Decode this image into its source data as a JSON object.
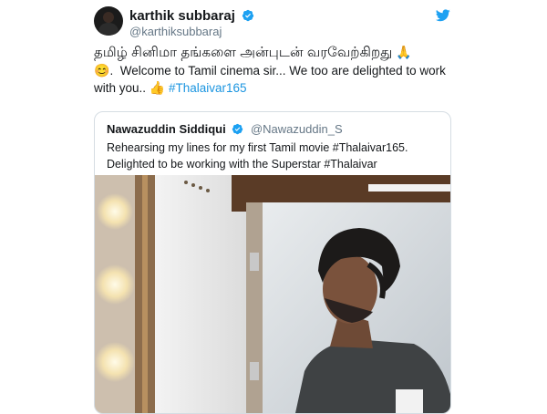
{
  "tweet": {
    "display_name": "karthik subbaraj",
    "handle": "@karthiksubbaraj",
    "text_tamil": "தமிழ் சினிமா தங்களை அன்புடன் வரவேற்கிறது",
    "text_english_line1": "Welcome to Tamil cinema sir... We too are delighted to work",
    "text_english_line2": "with you..",
    "hashtag": "#Thalaivar165",
    "emoji_pray": "🙏",
    "emoji_smile": "😊",
    "emoji_thumbs": "👍"
  },
  "quoted_tweet": {
    "display_name": "Nawazuddin Siddiqui",
    "handle": "@Nawazuddin_S",
    "text_line1": "Rehearsing my lines for my first Tamil movie #Thalaivar165.",
    "text_line2": "Delighted to be working with the Superstar #Thalaivar"
  },
  "icons": {
    "verified": "verified-badge-icon",
    "twitter": "twitter-bird-icon"
  },
  "colors": {
    "link_blue": "#1b95e0",
    "verified_blue": "#1da1f2",
    "secondary_text": "#657786"
  }
}
